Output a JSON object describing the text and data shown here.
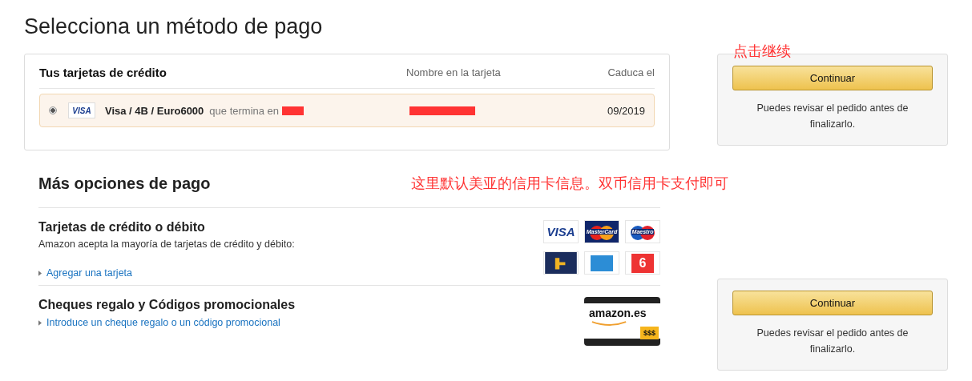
{
  "title": "Selecciona un método de pago",
  "saved_cards": {
    "heading": "Tus tarjetas de crédito",
    "col_name": "Nombre en la tarjeta",
    "col_expiry": "Caduca el",
    "rows": [
      {
        "selected": true,
        "logo": "VISA",
        "name": "Visa / 4B / Euro6000",
        "suffix": "que termina en",
        "redacted": true,
        "expiry": "09/2019"
      }
    ]
  },
  "more": {
    "heading": "Más opciones de pago",
    "sections": [
      {
        "kind": "cards",
        "title": "Tarjetas de crédito o débito",
        "description": "Amazon acepta la mayoría de tarjetas de crédito y débito:",
        "link": "Agregar una tarjeta",
        "logos": [
          {
            "kind": "visa",
            "text": "VISA"
          },
          {
            "kind": "mastercard",
            "text": "MasterCard"
          },
          {
            "kind": "maestro",
            "text": "Maestro"
          },
          {
            "kind": "fourb"
          },
          {
            "kind": "amex"
          },
          {
            "kind": "euro6000",
            "text": "6"
          }
        ]
      },
      {
        "kind": "giftcard",
        "title": "Cheques regalo y Códigos promocionales",
        "link": "Introduce un cheque regalo o un código promocional",
        "card_brand": "amazon.es",
        "card_amount": "$$$"
      }
    ]
  },
  "side_boxes": [
    {
      "button": "Continuar",
      "note": "Puedes revisar el pedido antes de finalizarlo."
    },
    {
      "button": "Continuar",
      "note": "Puedes revisar el pedido antes de finalizarlo."
    }
  ],
  "annotations": [
    {
      "text": "点击继续"
    },
    {
      "text": "这里默认美亚的信用卡信息。双币信用卡支付即可"
    }
  ]
}
